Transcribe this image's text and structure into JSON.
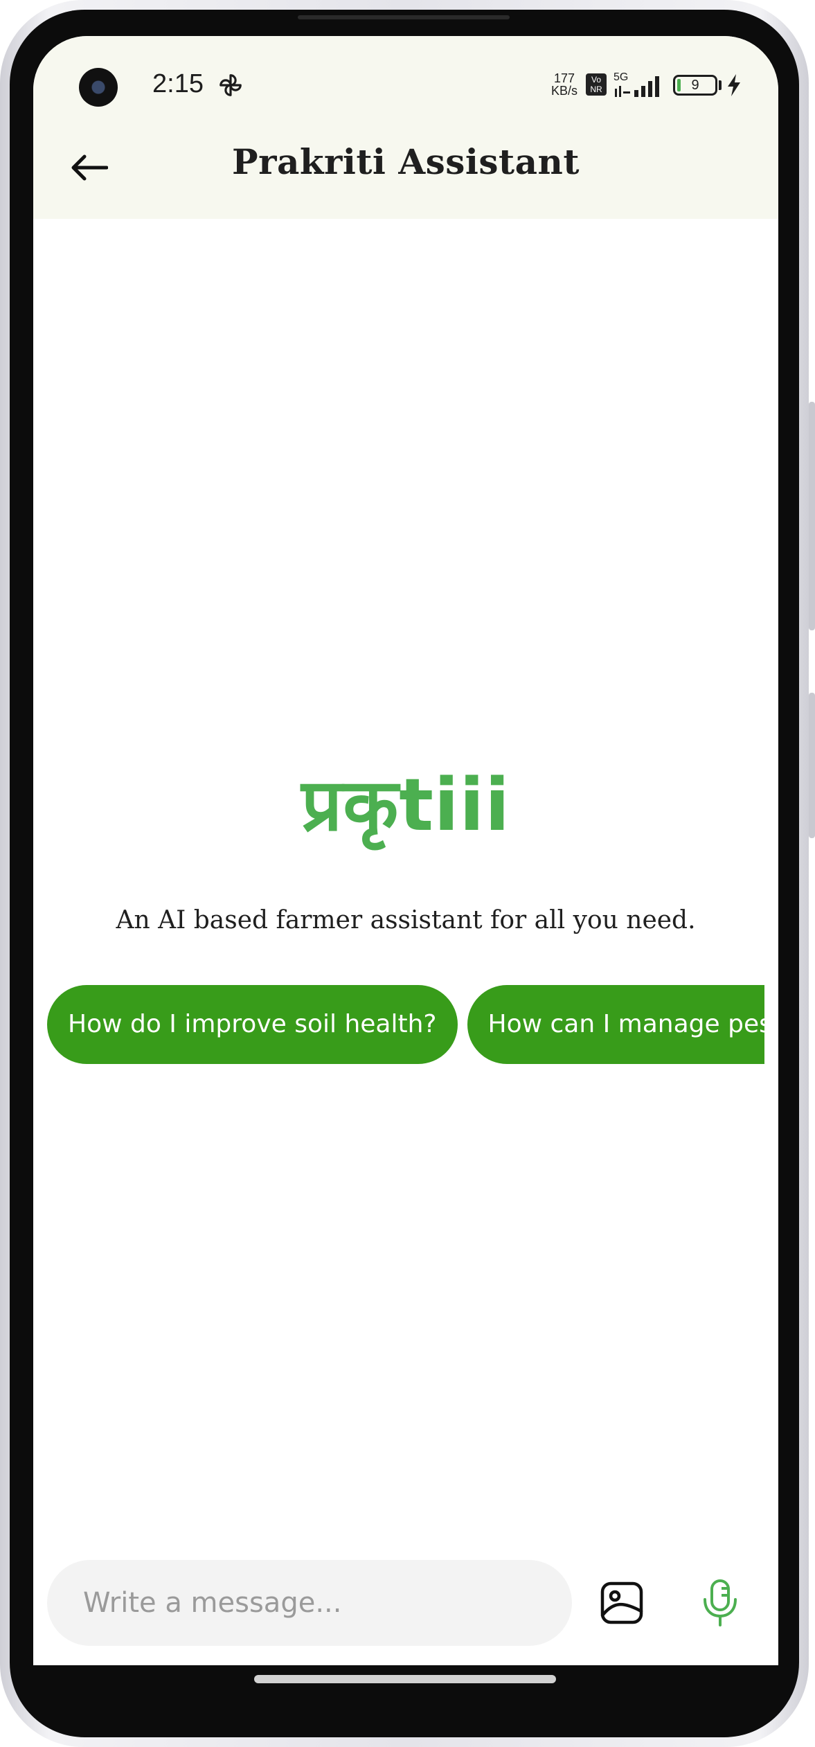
{
  "status_bar": {
    "time": "2:15",
    "net_speed_value": "177",
    "net_speed_unit": "KB/s",
    "volte_top": "Vo",
    "volte_bottom": "NR",
    "network_type": "5G",
    "battery_level": "9",
    "battery_fill_fraction": 0.09,
    "battery_fill_color": "#4caf50"
  },
  "header": {
    "title": "Prakriti Assistant",
    "back_icon": "arrow-left-icon"
  },
  "hero": {
    "logo_text": "प्रकृtiii",
    "logo_color": "#4caf50",
    "tagline": "An AI based farmer assistant for all you need."
  },
  "suggestions": {
    "chip_color": "#389c1a",
    "items": [
      {
        "label": "How do I improve soil health?"
      },
      {
        "label": "How can I manage pests organically?"
      }
    ]
  },
  "composer": {
    "placeholder": "Write a message...",
    "image_icon": "image-icon",
    "mic_icon": "microphone-icon",
    "mic_color": "#4caf50"
  },
  "colors": {
    "app_bar_bg": "#f7f8ef",
    "input_bg": "#f3f3f3"
  }
}
